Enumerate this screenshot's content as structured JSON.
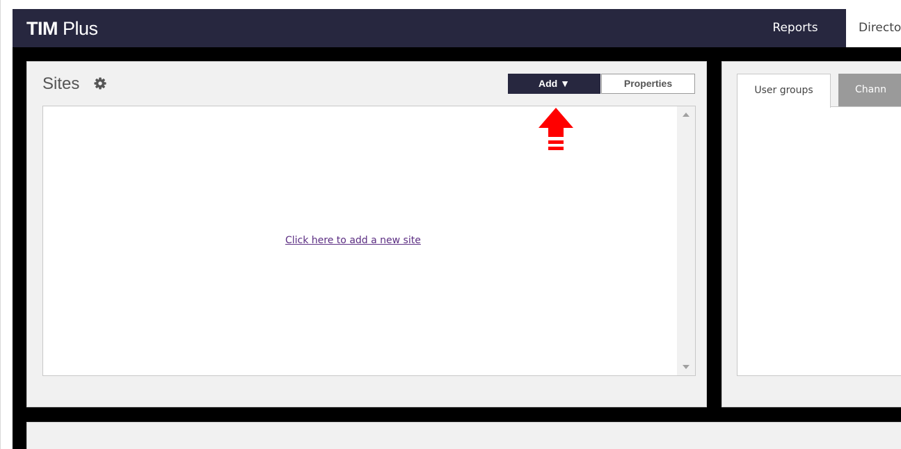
{
  "app": {
    "logo_bold": "TIM",
    "logo_light": " Plus"
  },
  "nav": {
    "reports": "Reports",
    "directory": "Directo"
  },
  "sites": {
    "title": "Sites",
    "add_button": "Add ▼",
    "properties_button": "Properties",
    "empty_link": "Click here to add a new site"
  },
  "right_panel": {
    "tabs": [
      {
        "label": "User groups",
        "active": true
      },
      {
        "label": "Chann",
        "active": false
      }
    ]
  },
  "colors": {
    "header": "#27273f",
    "add_button": "#27273f",
    "annotation_arrow": "#ff0000",
    "link": "#5b2d82",
    "inactive_tab": "#9a9a9a"
  },
  "icons": [
    "gear-icon",
    "scroll-up-icon",
    "scroll-down-icon",
    "red-up-arrow-annotation"
  ]
}
